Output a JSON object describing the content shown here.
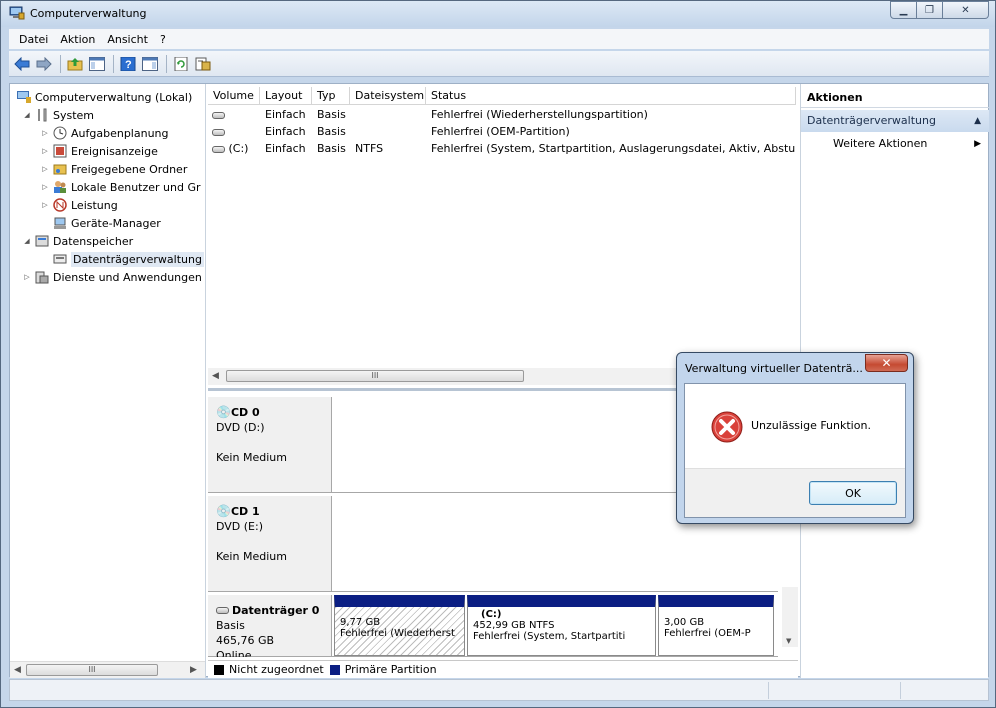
{
  "window": {
    "title": "Computerverwaltung"
  },
  "menu": [
    "Datei",
    "Aktion",
    "Ansicht",
    "?"
  ],
  "tree": [
    {
      "label": "Computerverwaltung (Lokal)",
      "icon": "computer-management-icon",
      "level": 0,
      "twisty": ""
    },
    {
      "label": "System",
      "icon": "tools-icon",
      "level": 1,
      "twisty": "◢"
    },
    {
      "label": "Aufgabenplanung",
      "icon": "clock-icon",
      "level": 2,
      "twisty": "▷"
    },
    {
      "label": "Ereignisanzeige",
      "icon": "event-viewer-icon",
      "level": 2,
      "twisty": "▷"
    },
    {
      "label": "Freigegebene Ordner",
      "icon": "shared-folder-icon",
      "level": 2,
      "twisty": "▷"
    },
    {
      "label": "Lokale Benutzer und Gr",
      "icon": "users-icon",
      "level": 2,
      "twisty": "▷"
    },
    {
      "label": "Leistung",
      "icon": "performance-icon",
      "level": 2,
      "twisty": "▷"
    },
    {
      "label": "Geräte-Manager",
      "icon": "device-manager-icon",
      "level": 2,
      "twisty": ""
    },
    {
      "label": "Datenspeicher",
      "icon": "storage-icon",
      "level": 1,
      "twisty": "◢"
    },
    {
      "label": "Datenträgerverwaltung",
      "icon": "disk-management-icon",
      "level": 2,
      "twisty": "",
      "selected": true
    },
    {
      "label": "Dienste und Anwendungen",
      "icon": "services-icon",
      "level": 1,
      "twisty": "▷"
    }
  ],
  "volumes": {
    "headers": [
      "Volume",
      "Layout",
      "Typ",
      "Dateisystem",
      "Status"
    ],
    "rows": [
      {
        "volume": "",
        "layout": "Einfach",
        "typ": "Basis",
        "fs": "",
        "status": "Fehlerfrei (Wiederherstellungspartition)"
      },
      {
        "volume": "",
        "layout": "Einfach",
        "typ": "Basis",
        "fs": "",
        "status": "Fehlerfrei (OEM-Partition)"
      },
      {
        "volume": "(C:)",
        "layout": "Einfach",
        "typ": "Basis",
        "fs": "NTFS",
        "status": "Fehlerfrei (System, Startpartition, Auslagerungsdatei, Aktiv, Absturzab"
      }
    ],
    "scroll_label": "III"
  },
  "disks": [
    {
      "name": "CD 0",
      "line1": "DVD (D:)",
      "line2": "",
      "line3": "Kein Medium"
    },
    {
      "name": "CD 1",
      "line1": "DVD (E:)",
      "line2": "",
      "line3": "Kein Medium"
    },
    {
      "name": "Datenträger 0",
      "line1": "Basis",
      "line2": "465,76 GB",
      "line3": "Online"
    }
  ],
  "partitions": [
    {
      "name": "",
      "size": "9,77 GB",
      "status": "Fehlerfrei (Wiederherst"
    },
    {
      "name": "(C:)",
      "size": "452,99 GB NTFS",
      "status": "Fehlerfrei (System, Startpartiti"
    },
    {
      "name": "",
      "size": "3,00 GB",
      "status": "Fehlerfrei (OEM-P"
    }
  ],
  "legend": [
    {
      "label": "Nicht zugeordnet",
      "color": "#000000"
    },
    {
      "label": "Primäre Partition",
      "color": "#0b1e83"
    }
  ],
  "actions": {
    "header": "Aktionen",
    "section": "Datenträgerverwaltung",
    "item": "Weitere Aktionen"
  },
  "dialog": {
    "title": "Verwaltung virtueller Datenträ...",
    "message": "Unzulässige Funktion.",
    "ok_label": "OK",
    "icon": "error-icon"
  },
  "tree_scroll_label": "III"
}
